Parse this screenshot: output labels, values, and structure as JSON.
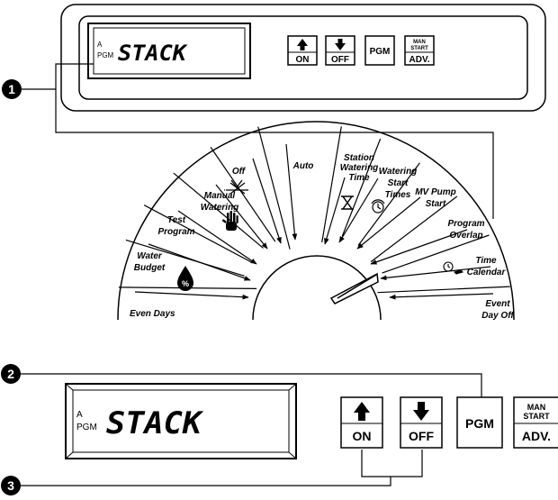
{
  "lcd": {
    "indicator_a": "A",
    "indicator_pgm": "PGM",
    "text": "STACK"
  },
  "buttons": {
    "on": "ON",
    "off": "OFF",
    "pgm": "PGM",
    "man": "MAN",
    "start": "START",
    "adv": "ADV."
  },
  "callouts": [
    "1",
    "2",
    "3"
  ],
  "dial": {
    "positions": [
      "Even  Days",
      "Water Budget",
      "Test Program",
      "Manual Watering",
      "Off",
      "Auto",
      "Station Watering Time",
      "Watering Start Times",
      "MV Pump Start",
      "Program Overlap",
      "Time Calendar",
      "Event Day Off"
    ]
  }
}
